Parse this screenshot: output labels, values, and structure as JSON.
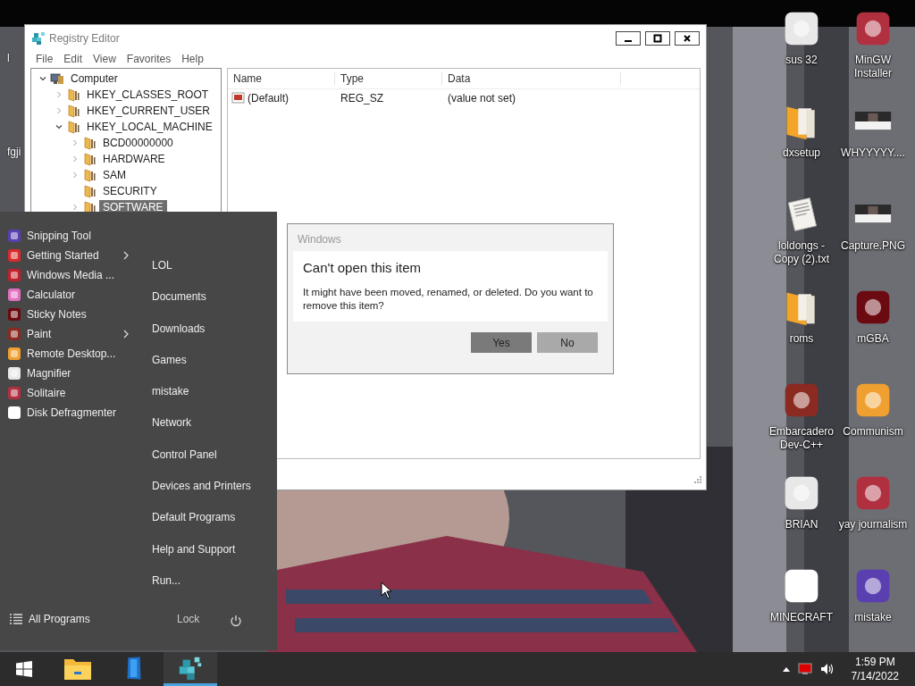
{
  "left_icons": [
    {
      "label": "l"
    },
    {
      "label": "fgji"
    }
  ],
  "registry_editor": {
    "title": "Registry Editor",
    "menu": [
      "File",
      "Edit",
      "View",
      "Favorites",
      "Help"
    ],
    "tree": [
      {
        "label": "Computer",
        "kind": "computer",
        "has_children": true,
        "expanded": true,
        "selected": false,
        "children": [
          {
            "label": "HKEY_CLASSES_ROOT",
            "kind": "folder",
            "has_children": true,
            "expanded": false,
            "selected": false
          },
          {
            "label": "HKEY_CURRENT_USER",
            "kind": "folder",
            "has_children": true,
            "expanded": false,
            "selected": false
          },
          {
            "label": "HKEY_LOCAL_MACHINE",
            "kind": "folder",
            "has_children": true,
            "expanded": true,
            "selected": false,
            "children": [
              {
                "label": "BCD00000000",
                "kind": "folder",
                "has_children": true,
                "expanded": false,
                "selected": false
              },
              {
                "label": "HARDWARE",
                "kind": "folder",
                "has_children": true,
                "expanded": false,
                "selected": false
              },
              {
                "label": "SAM",
                "kind": "folder",
                "has_children": true,
                "expanded": false,
                "selected": false
              },
              {
                "label": "SECURITY",
                "kind": "folder",
                "has_children": false,
                "selected": false
              },
              {
                "label": "SOFTWARE",
                "kind": "folder",
                "has_children": true,
                "expanded": false,
                "selected": true
              }
            ]
          }
        ]
      }
    ],
    "columns": [
      "Name",
      "Type",
      "Data"
    ],
    "rows": [
      {
        "name": "(Default)",
        "type": "REG_SZ",
        "data": "(value not set)"
      }
    ]
  },
  "dialog": {
    "caption": "Windows",
    "heading": "Can't open this item",
    "message": "It might have been moved, renamed, or deleted. Do you want to remove this item?",
    "buttons": [
      {
        "label": "Yes",
        "selected": true
      },
      {
        "label": "No",
        "selected": false
      }
    ]
  },
  "start_menu": {
    "programs": [
      {
        "label": "Snipping Tool",
        "submenu": false
      },
      {
        "label": "Getting Started",
        "submenu": true
      },
      {
        "label": "Windows Media ...",
        "submenu": false
      },
      {
        "label": "Calculator",
        "submenu": false
      },
      {
        "label": "Sticky Notes",
        "submenu": false
      },
      {
        "label": "Paint",
        "submenu": true
      },
      {
        "label": "Remote Desktop...",
        "submenu": false
      },
      {
        "label": "Magnifier",
        "submenu": false
      },
      {
        "label": "Solitaire",
        "submenu": false
      },
      {
        "label": "Disk Defragmenter",
        "submenu": false
      }
    ],
    "places": [
      "LOL",
      "Documents",
      "Downloads",
      "Games",
      "mistake",
      "Network",
      "Control Panel",
      "Devices and Printers",
      "Default Programs",
      "Help and Support",
      "Run..."
    ],
    "all_programs": "All Programs",
    "lock": "Lock"
  },
  "desktop_icons": [
    {
      "label": "sus 32",
      "kind": "app"
    },
    {
      "label": "MinGW Installer",
      "kind": "app"
    },
    {
      "label": "dxsetup",
      "kind": "folder"
    },
    {
      "label": "WHYYYYY...."
    },
    {
      "label": "loldongs - Copy (2).txt",
      "kind": "document"
    },
    {
      "label": "Capture.PNG"
    },
    {
      "label": "roms",
      "kind": "folder"
    },
    {
      "label": "mGBA",
      "kind": "app"
    },
    {
      "label": "Embarcadero Dev-C++",
      "kind": "app"
    },
    {
      "label": "Communism",
      "kind": "app"
    },
    {
      "label": "BRIAN",
      "kind": "app"
    },
    {
      "label": "yay journalism",
      "kind": "app"
    },
    {
      "label": "MINECRAFT",
      "kind": "app"
    },
    {
      "label": "mistake",
      "kind": "app"
    }
  ],
  "taskbar": {
    "apps": [
      {
        "kind": "folder",
        "selected": false
      },
      {
        "kind": "tablet",
        "selected": false
      },
      {
        "kind": "cubes",
        "selected": true
      }
    ],
    "time": "1:59 PM",
    "date": "7/14/2022"
  }
}
